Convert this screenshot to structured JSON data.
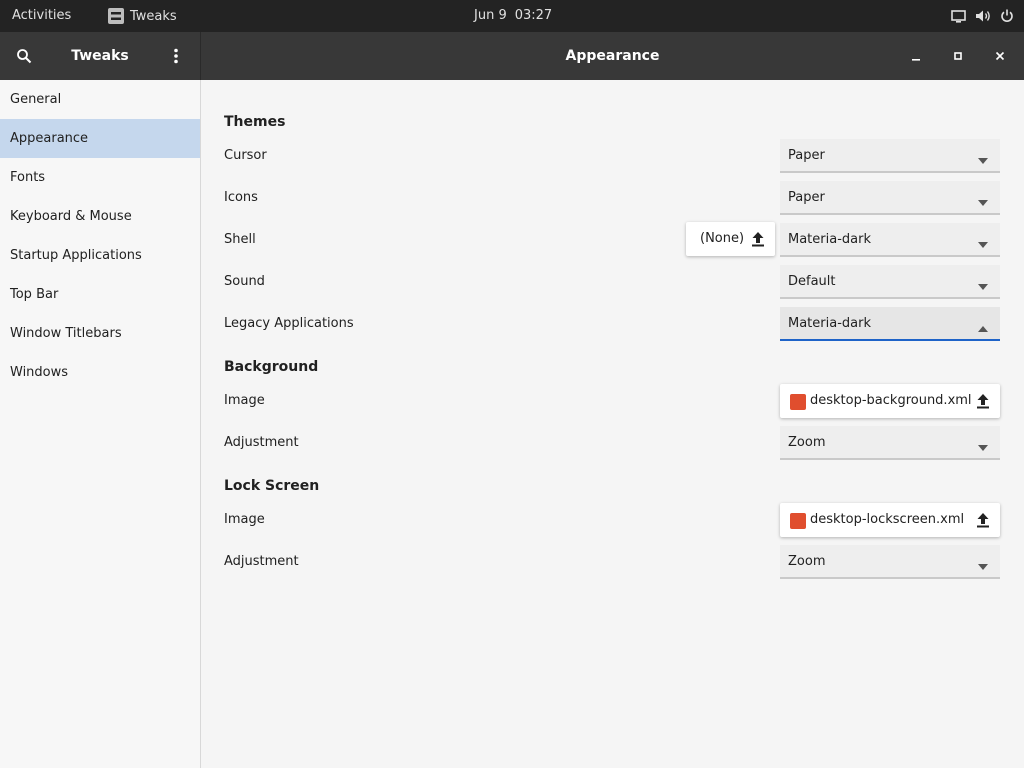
{
  "topbar": {
    "activities": "Activities",
    "app_name": "Tweaks",
    "date": "Jun 9",
    "time": "03:27",
    "tray_icons": [
      "screen-icon",
      "volume-icon",
      "power-icon"
    ]
  },
  "headerbar": {
    "sidebar_title": "Tweaks",
    "page_title": "Appearance",
    "left_icons": [
      "search-icon",
      "menu-dots-icon"
    ],
    "window_controls": [
      "minimize-icon",
      "maximize-icon",
      "close-icon"
    ]
  },
  "sidebar": {
    "items": [
      {
        "label": "General",
        "selected": false
      },
      {
        "label": "Appearance",
        "selected": true
      },
      {
        "label": "Fonts",
        "selected": false
      },
      {
        "label": "Keyboard & Mouse",
        "selected": false
      },
      {
        "label": "Startup Applications",
        "selected": false
      },
      {
        "label": "Top Bar",
        "selected": false
      },
      {
        "label": "Window Titlebars",
        "selected": false
      },
      {
        "label": "Windows",
        "selected": false
      }
    ]
  },
  "themes": {
    "title": "Themes",
    "cursor": {
      "label": "Cursor",
      "value": "Paper"
    },
    "icons": {
      "label": "Icons",
      "value": "Paper"
    },
    "shell": {
      "label": "Shell",
      "value": "Materia-dark",
      "file_button": "(None)"
    },
    "sound": {
      "label": "Sound",
      "value": "Default"
    },
    "legacy": {
      "label": "Legacy Applications",
      "value": "Materia-dark",
      "state": "open"
    }
  },
  "background": {
    "title": "Background",
    "image": {
      "label": "Image",
      "file": "desktop-background.xml"
    },
    "adjustment": {
      "label": "Adjustment",
      "value": "Zoom"
    }
  },
  "lockscreen": {
    "title": "Lock Screen",
    "image": {
      "label": "Image",
      "file": "desktop-lockscreen.xml"
    },
    "adjustment": {
      "label": "Adjustment",
      "value": "Zoom"
    }
  },
  "colors": {
    "topbar": "#232323",
    "headerbar": "#383838",
    "selected_row": "#c5d7ed",
    "accent": "#1e63c8",
    "file_icon": "#e04e2e"
  }
}
